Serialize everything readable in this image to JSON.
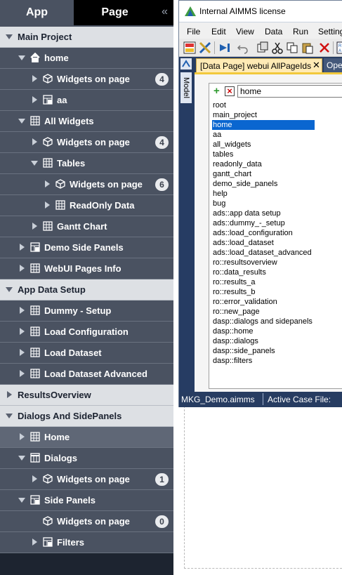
{
  "sidebar": {
    "tabs": {
      "app": "App",
      "page": "Page",
      "collapse": "«"
    },
    "rows": [
      {
        "label": "Main Project",
        "level": 0,
        "expanded": true,
        "icon": "none",
        "header": true
      },
      {
        "label": "home",
        "level": 1,
        "expanded": true,
        "icon": "home-icon"
      },
      {
        "label": "Widgets on page",
        "level": 2,
        "expanded": false,
        "icon": "cube-icon",
        "badge": "4"
      },
      {
        "label": "aa",
        "level": 2,
        "expanded": false,
        "icon": "side-panel-icon"
      },
      {
        "label": "All Widgets",
        "level": 1,
        "expanded": true,
        "icon": "grid-icon"
      },
      {
        "label": "Widgets on page",
        "level": 2,
        "expanded": false,
        "icon": "cube-icon",
        "badge": "4"
      },
      {
        "label": "Tables",
        "level": 2,
        "expanded": true,
        "icon": "grid-icon"
      },
      {
        "label": "Widgets on page",
        "level": 3,
        "expanded": false,
        "icon": "cube-icon",
        "badge": "6"
      },
      {
        "label": "ReadOnly Data",
        "level": 3,
        "expanded": false,
        "icon": "grid-icon"
      },
      {
        "label": "Gantt Chart",
        "level": 2,
        "expanded": false,
        "icon": "grid-icon"
      },
      {
        "label": "Demo Side Panels",
        "level": 1,
        "expanded": false,
        "icon": "side-panel-icon"
      },
      {
        "label": "WebUI Pages Info",
        "level": 1,
        "expanded": false,
        "icon": "grid-icon"
      },
      {
        "label": "App Data Setup",
        "level": 0,
        "expanded": true,
        "icon": "none",
        "header": true
      },
      {
        "label": "Dummy - Setup",
        "level": 1,
        "expanded": false,
        "icon": "grid-icon"
      },
      {
        "label": "Load Configuration",
        "level": 1,
        "expanded": false,
        "icon": "grid-icon"
      },
      {
        "label": "Load Dataset",
        "level": 1,
        "expanded": false,
        "icon": "grid-icon"
      },
      {
        "label": "Load Dataset Advanced",
        "level": 1,
        "expanded": false,
        "icon": "grid-icon"
      },
      {
        "label": "ResultsOverview",
        "level": 0,
        "expanded": false,
        "icon": "none",
        "header": true
      },
      {
        "label": "Dialogs And SidePanels",
        "level": 0,
        "expanded": true,
        "icon": "none",
        "header": true
      },
      {
        "label": "Home",
        "level": 1,
        "expanded": false,
        "icon": "grid-icon",
        "selected": true
      },
      {
        "label": "Dialogs",
        "level": 1,
        "expanded": true,
        "icon": "dialog-icon"
      },
      {
        "label": "Widgets on page",
        "level": 2,
        "expanded": false,
        "icon": "cube-icon",
        "badge": "1"
      },
      {
        "label": "Side Panels",
        "level": 1,
        "expanded": true,
        "icon": "side-panel-icon"
      },
      {
        "label": "Widgets on page",
        "level": 2,
        "expanded": false,
        "icon": "cube-icon",
        "badge": "0",
        "noarrow": true
      },
      {
        "label": "Filters",
        "level": 2,
        "expanded": false,
        "icon": "side-panel-icon"
      }
    ]
  },
  "window": {
    "title": "Internal AIMMS license",
    "menu": [
      "File",
      "Edit",
      "View",
      "Data",
      "Run",
      "Setting"
    ],
    "side_tab": "Model",
    "doc_tab": "[Data Page] webui AllPageIds",
    "doc_tab_close": "✕",
    "doc_tab2": "Ope",
    "search_value": "home",
    "list": [
      "root",
      "main_project",
      "home",
      "aa",
      "all_widgets",
      "tables",
      "readonly_data",
      "gantt_chart",
      "demo_side_panels",
      "help",
      "bug",
      "ads::app data setup",
      "ads::dummy_-_setup",
      "ads::load_configuration",
      "ads::load_dataset",
      "ads::load_dataset_advanced",
      "ro::resultsoverview",
      "ro::data_results",
      "ro::results_a",
      "ro::results_b",
      "ro::error_validation",
      "ro::new_page",
      "dasp::dialogs and sidepanels",
      "dasp::home",
      "dasp::dialogs",
      "dasp::side_panels",
      "dasp::filters"
    ],
    "selected_item": "home",
    "status_file": "MKG_Demo.aimms",
    "status_case": "Active Case File:"
  },
  "colors": {
    "sidebar_bg": "#4a5261",
    "header_bg": "#dde0e4",
    "selection": "#0a66d0",
    "doc_tab": "#ffeab5"
  }
}
